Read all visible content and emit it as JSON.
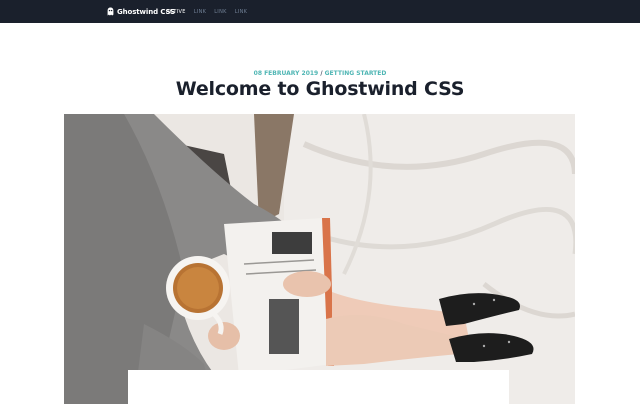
{
  "navbar": {
    "brand": {
      "icon": "ghost-icon",
      "text": "Ghostwind CSS"
    },
    "links": [
      {
        "label": "ACTIVE",
        "active": true
      },
      {
        "label": "LINK",
        "active": false
      },
      {
        "label": "LINK",
        "active": false
      },
      {
        "label": "LINK",
        "active": false
      }
    ]
  },
  "post": {
    "date": "08 FEBRUARY 2019",
    "separator": "/",
    "category": "GETTING STARTED",
    "title": "Welcome to Ghostwind CSS",
    "hero_image": "woman-reading-book-with-coffee-on-bed"
  },
  "colors": {
    "navbar_bg": "#1a202c",
    "accent": "#4fb6b4",
    "title": "#1a202c"
  }
}
